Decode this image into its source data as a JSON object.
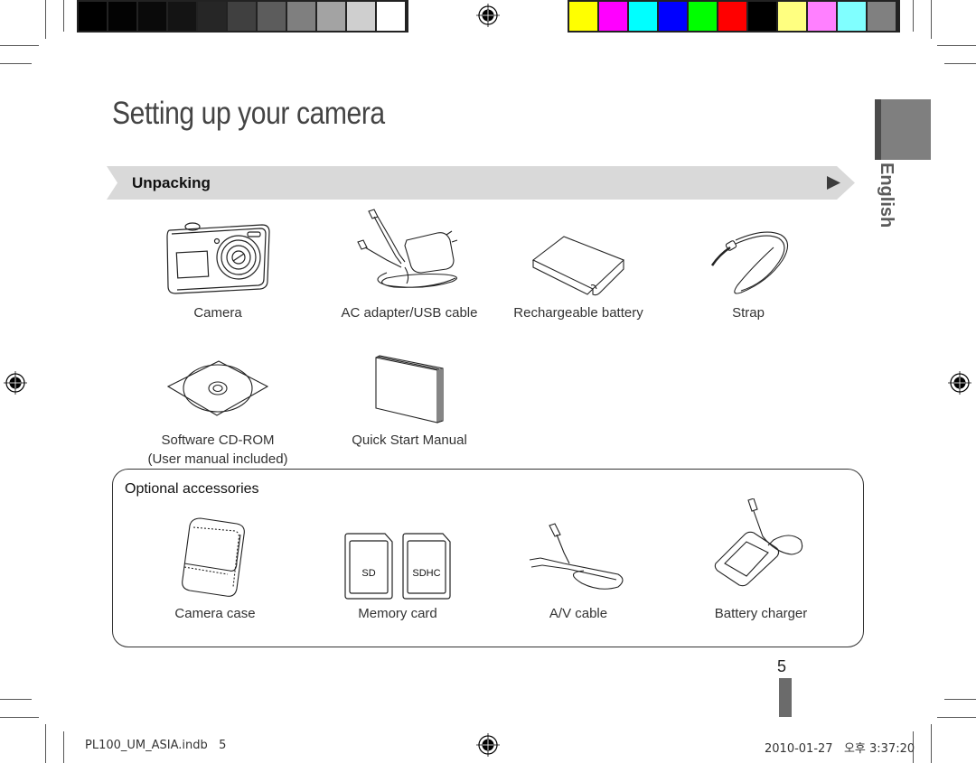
{
  "print_marks": {
    "grayscale_swatches": [
      "#000000",
      "#030303",
      "#0a0a0a",
      "#141414",
      "#262626",
      "#404040",
      "#5c5c5c",
      "#7f7f7f",
      "#a3a3a3",
      "#cfcfcf",
      "#ffffff"
    ],
    "color_swatches": [
      "#ffff00",
      "#ff00ff",
      "#00ffff",
      "#0000ff",
      "#00ff00",
      "#ff0000",
      "#000000",
      "#ffff80",
      "#ff80ff",
      "#80ffff",
      "#808080"
    ]
  },
  "page": {
    "title": "Setting up your camera",
    "language_tab": "English",
    "page_number": "5"
  },
  "unpacking": {
    "heading": "Unpacking",
    "items": [
      {
        "label": "Camera",
        "icon": "camera-icon"
      },
      {
        "label": "AC adapter/USB cable",
        "icon": "ac-adapter-icon"
      },
      {
        "label": "Rechargeable battery",
        "icon": "battery-icon"
      },
      {
        "label": "Strap",
        "icon": "strap-icon"
      },
      {
        "label": "Software CD-ROM",
        "sublabel": "(User manual included)",
        "icon": "cd-rom-icon"
      },
      {
        "label": "Quick Start Manual",
        "icon": "manual-icon"
      }
    ]
  },
  "optional_accessories": {
    "heading": "Optional accessories",
    "items": [
      {
        "label": "Camera case",
        "icon": "camera-case-icon"
      },
      {
        "label": "Memory card",
        "icon": "memory-card-icon",
        "card_labels": [
          "SD",
          "SDHC"
        ]
      },
      {
        "label": "A/V cable",
        "icon": "av-cable-icon"
      },
      {
        "label": "Battery charger",
        "icon": "battery-charger-icon"
      }
    ]
  },
  "slug": {
    "file": "PL100_UM_ASIA.indb   5",
    "timestamp": "2010-01-27   오후 3:37:20"
  },
  "colors": {
    "banner_bg": "#d9d9d9",
    "tab_gray": "#7f7f7f",
    "tab_dark": "#4b4b4b",
    "title_gray": "#444444"
  }
}
